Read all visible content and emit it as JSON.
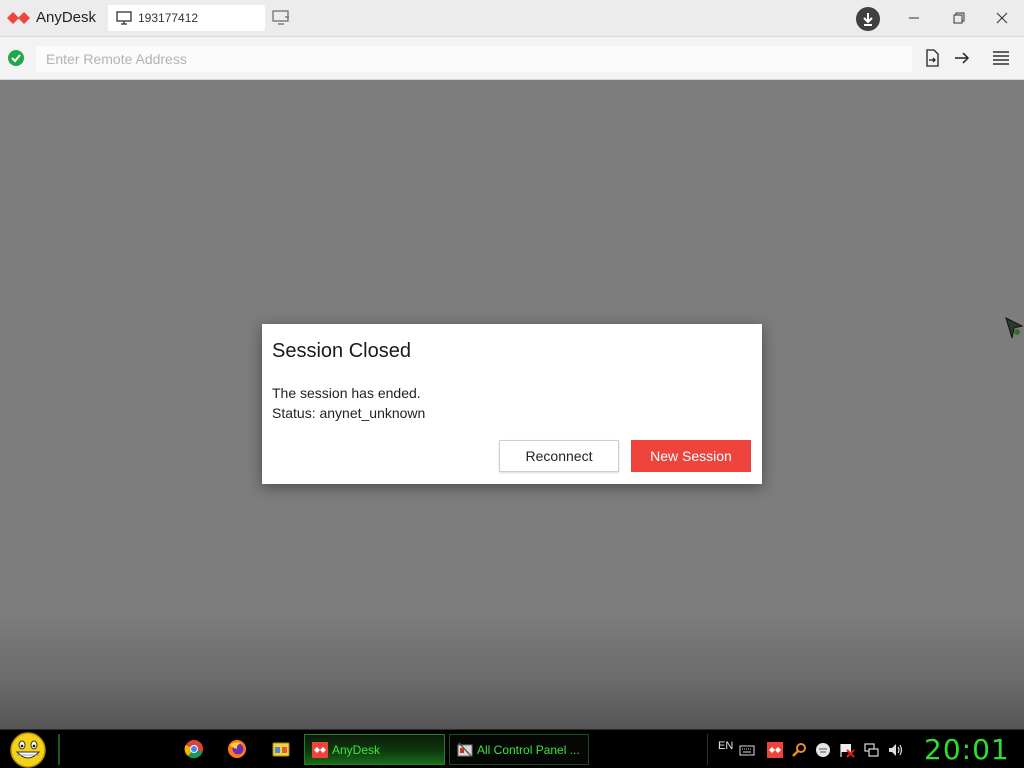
{
  "titlebar": {
    "app_name": "AnyDesk",
    "tab_label": "193177412"
  },
  "addressbar": {
    "placeholder": "Enter Remote Address"
  },
  "dialog": {
    "title": "Session Closed",
    "message": "The session has ended.",
    "status": "Status: anynet_unknown",
    "reconnect_label": "Reconnect",
    "new_session_label": "New Session"
  },
  "taskbar": {
    "tasks": [
      {
        "label": "AnyDesk",
        "active": true
      },
      {
        "label": "All Control Panel ...",
        "active": false
      }
    ],
    "language": "EN",
    "clock": "20:01"
  },
  "colors": {
    "brand_red": "#ef443b",
    "status_green": "#21a84a",
    "taskbar_green": "#2ee02e",
    "remote_background": "#7d7d7d"
  },
  "icons": [
    "anydesk-logo-icon",
    "monitor-icon",
    "new-tab-icon",
    "download-icon",
    "minimize-icon",
    "restore-icon",
    "close-icon",
    "status-ok-icon",
    "file-transfer-icon",
    "connect-arrow-icon",
    "hamburger-menu-icon",
    "chrome-icon",
    "firefox-icon",
    "folder-icon",
    "keyboard-icon",
    "search-icon",
    "network-icon",
    "volume-icon"
  ]
}
